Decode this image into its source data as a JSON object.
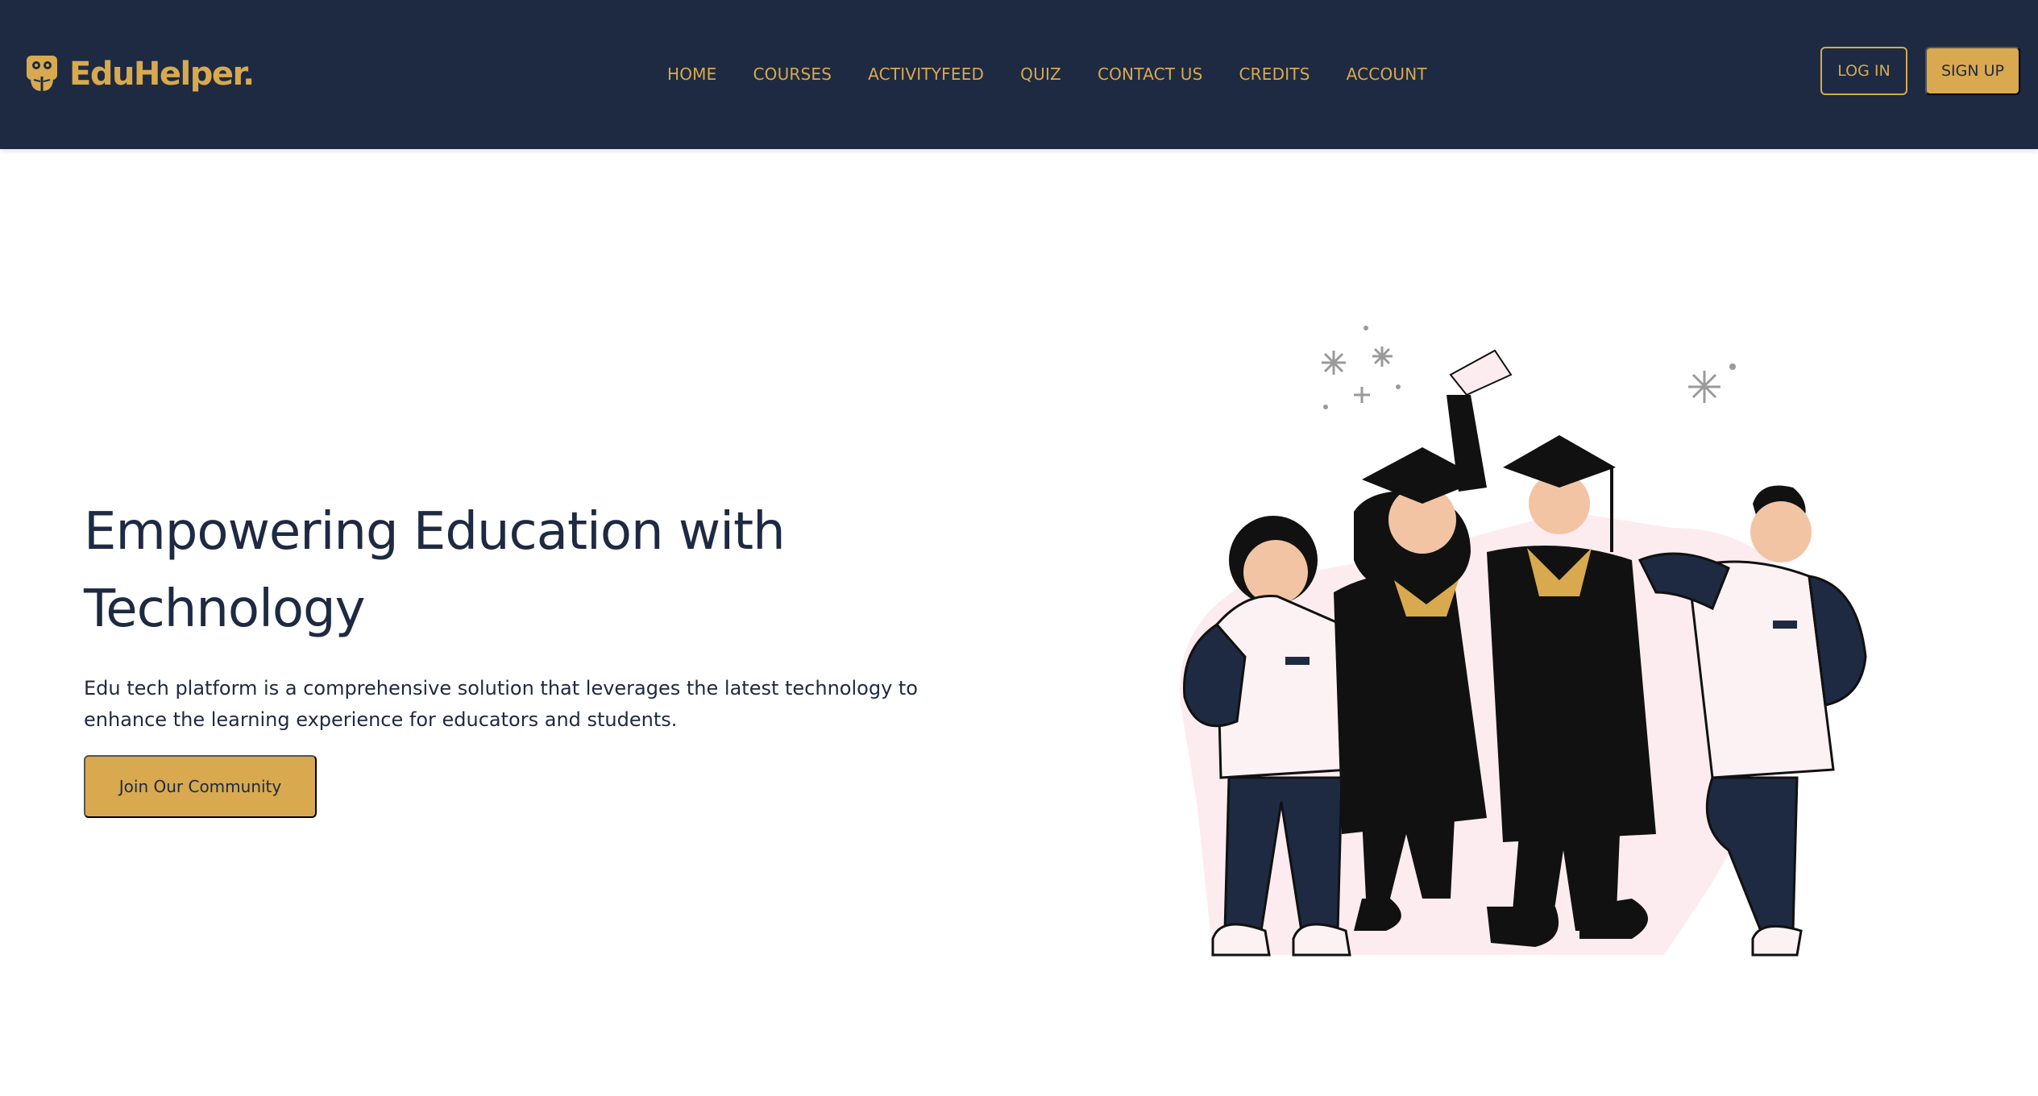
{
  "brand": {
    "name": "EduHelper.",
    "accent_color": "#d8a94e",
    "nav_background": "#1d2a42",
    "logo_icon": "owl-book-icon"
  },
  "nav": {
    "items": [
      {
        "label": "HOME"
      },
      {
        "label": "COURSES"
      },
      {
        "label": "ACTIVITYFEED"
      },
      {
        "label": "QUIZ"
      },
      {
        "label": "CONTACT US"
      },
      {
        "label": "CREDITS"
      },
      {
        "label": "ACCOUNT"
      }
    ],
    "login_label": "LOG IN",
    "signup_label": "SIGN UP"
  },
  "hero": {
    "title": "Empowering Education with Technology",
    "description": "Edu tech platform is a comprehensive solution that leverages the latest technology to enhance the learning experience for educators and students.",
    "cta_label": "Join Our Community",
    "illustration": "graduating-students-illustration"
  }
}
